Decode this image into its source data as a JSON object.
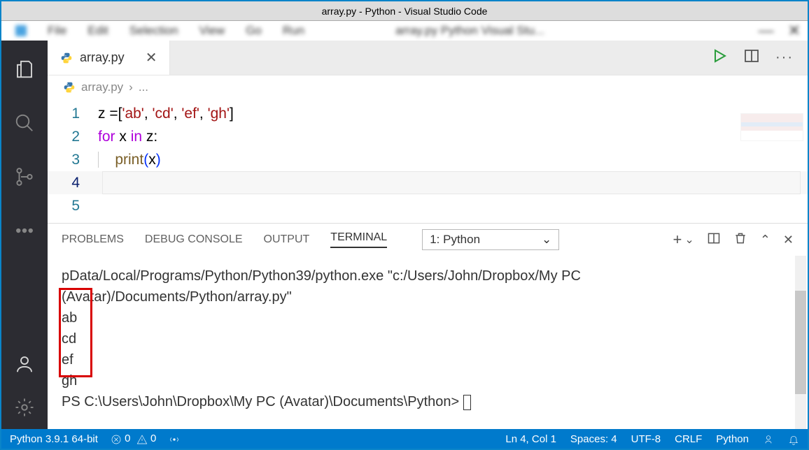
{
  "window": {
    "title": "array.py - Python - Visual Studio Code"
  },
  "menubar": {
    "items": [
      "File",
      "Edit",
      "Selection",
      "View",
      "Go",
      "Run"
    ],
    "overflow": "array.py  Python  Visual Stu..."
  },
  "tab": {
    "name": "array.py"
  },
  "breadcrumb": {
    "file": "array.py",
    "sep": "›",
    "more": "..."
  },
  "code": {
    "lines": {
      "l1_pre": "z =[",
      "l1_s1": "'ab'",
      "l1_c": ", ",
      "l1_s2": "'cd'",
      "l1_s3": "'ef'",
      "l1_s4": "'gh'",
      "l1_close": "]",
      "l2_for": "for",
      "l2_x": " x ",
      "l2_in": "in",
      "l2_z": " z:",
      "l3_print": "print",
      "l3_open": "(",
      "l3_arg": "x",
      "l3_close": ")"
    },
    "nums": {
      "n1": "1",
      "n2": "2",
      "n3": "3",
      "n4": "4",
      "n5": "5"
    }
  },
  "panel": {
    "tabs": {
      "problems": "PROBLEMS",
      "debug": "DEBUG CONSOLE",
      "output": "OUTPUT",
      "terminal": "TERMINAL"
    },
    "selector": "1: Python"
  },
  "terminal": {
    "line1": "pData/Local/Programs/Python/Python39/python.exe \"c:/Users/John/Dropbox/My PC",
    "line2": " (Avatar)/Documents/Python/array.py\"",
    "out1": "ab",
    "out2": "cd",
    "out3": "ef",
    "out4": "gh",
    "prompt": "PS C:\\Users\\John\\Dropbox\\My PC (Avatar)\\Documents\\Python> "
  },
  "status": {
    "python": "Python 3.9.1 64-bit",
    "errors": "0",
    "warnings": "0",
    "pos": "Ln 4, Col 1",
    "spaces": "Spaces: 4",
    "enc": "UTF-8",
    "eol": "CRLF",
    "lang": "Python"
  }
}
